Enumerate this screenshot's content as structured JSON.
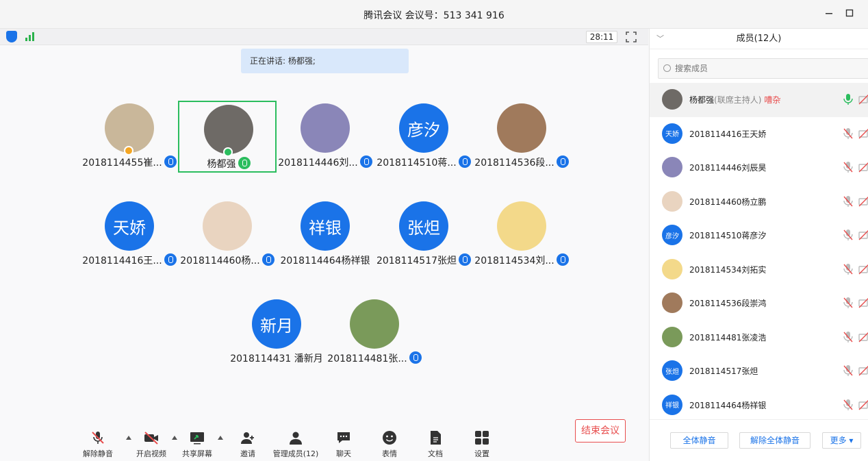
{
  "window": {
    "title": "腾讯会议 会议号：513 341 916"
  },
  "status": {
    "timer": "28:11",
    "speaking": "正在讲话: 杨都强;"
  },
  "participants": [
    {
      "name": "2018114455崔...",
      "avatar_text": "",
      "avatar_color": "#c9b79a"
    },
    {
      "name": "杨都强",
      "avatar_text": "",
      "avatar_color": "#6e6a66",
      "active": true
    },
    {
      "name": "2018114446刘...",
      "avatar_text": "",
      "avatar_color": "#8a86b8"
    },
    {
      "name": "2018114510蒋...",
      "avatar_text": "彦汐",
      "avatar_color": "#1a73e8"
    },
    {
      "name": "2018114536段...",
      "avatar_text": "",
      "avatar_color": "#a07a5c"
    },
    {
      "name": "2018114416王...",
      "avatar_text": "天娇",
      "avatar_color": "#1a73e8"
    },
    {
      "name": "2018114460杨...",
      "avatar_text": "",
      "avatar_color": "#e9d4c0"
    },
    {
      "name": "2018114464杨祥银",
      "avatar_text": "祥银",
      "avatar_color": "#1a73e8"
    },
    {
      "name": "2018114517张炟",
      "avatar_text": "张炟",
      "avatar_color": "#1a73e8"
    },
    {
      "name": "2018114534刘...",
      "avatar_text": "",
      "avatar_color": "#f3d98a"
    },
    {
      "name": "2018114431 潘新月",
      "avatar_text": "新月",
      "avatar_color": "#1a73e8"
    },
    {
      "name": "2018114481张...",
      "avatar_text": "",
      "avatar_color": "#7a9a5a"
    }
  ],
  "toolbar": {
    "unmute": "解除静音",
    "video": "开启视频",
    "share": "共享屏幕",
    "invite": "邀请",
    "manage": "管理成员(12)",
    "chat": "聊天",
    "emoji": "表情",
    "doc": "文档",
    "settings": "设置",
    "end": "结束会议"
  },
  "members_panel": {
    "title": "成员(12人)",
    "search_placeholder": "搜索成员",
    "members": [
      {
        "name": "杨都强",
        "role": "(联席主持人)",
        "tag": "嘈杂",
        "avatar_text": "",
        "avatar_color": "#6e6a66"
      },
      {
        "name": "2018114416王天娇",
        "avatar_text": "天娇",
        "avatar_color": "#1a73e8"
      },
      {
        "name": "2018114446刘辰昊",
        "avatar_text": "",
        "avatar_color": "#8a86b8"
      },
      {
        "name": "2018114460杨立鹏",
        "avatar_text": "",
        "avatar_color": "#e9d4c0"
      },
      {
        "name": "2018114510蒋彦汐",
        "avatar_text": "彦汐",
        "avatar_color": "#1a73e8"
      },
      {
        "name": "2018114534刘拓实",
        "avatar_text": "",
        "avatar_color": "#f3d98a"
      },
      {
        "name": "2018114536段崇鸿",
        "avatar_text": "",
        "avatar_color": "#a07a5c"
      },
      {
        "name": "2018114481张凌浩",
        "avatar_text": "",
        "avatar_color": "#7a9a5a"
      },
      {
        "name": "2018114517张炟",
        "avatar_text": "张炟",
        "avatar_color": "#1a73e8"
      },
      {
        "name": "2018114464杨祥银",
        "avatar_text": "祥银",
        "avatar_color": "#1a73e8"
      }
    ],
    "mute_all": "全体静音",
    "unmute_all": "解除全体静音",
    "more": "更多 ▾"
  }
}
